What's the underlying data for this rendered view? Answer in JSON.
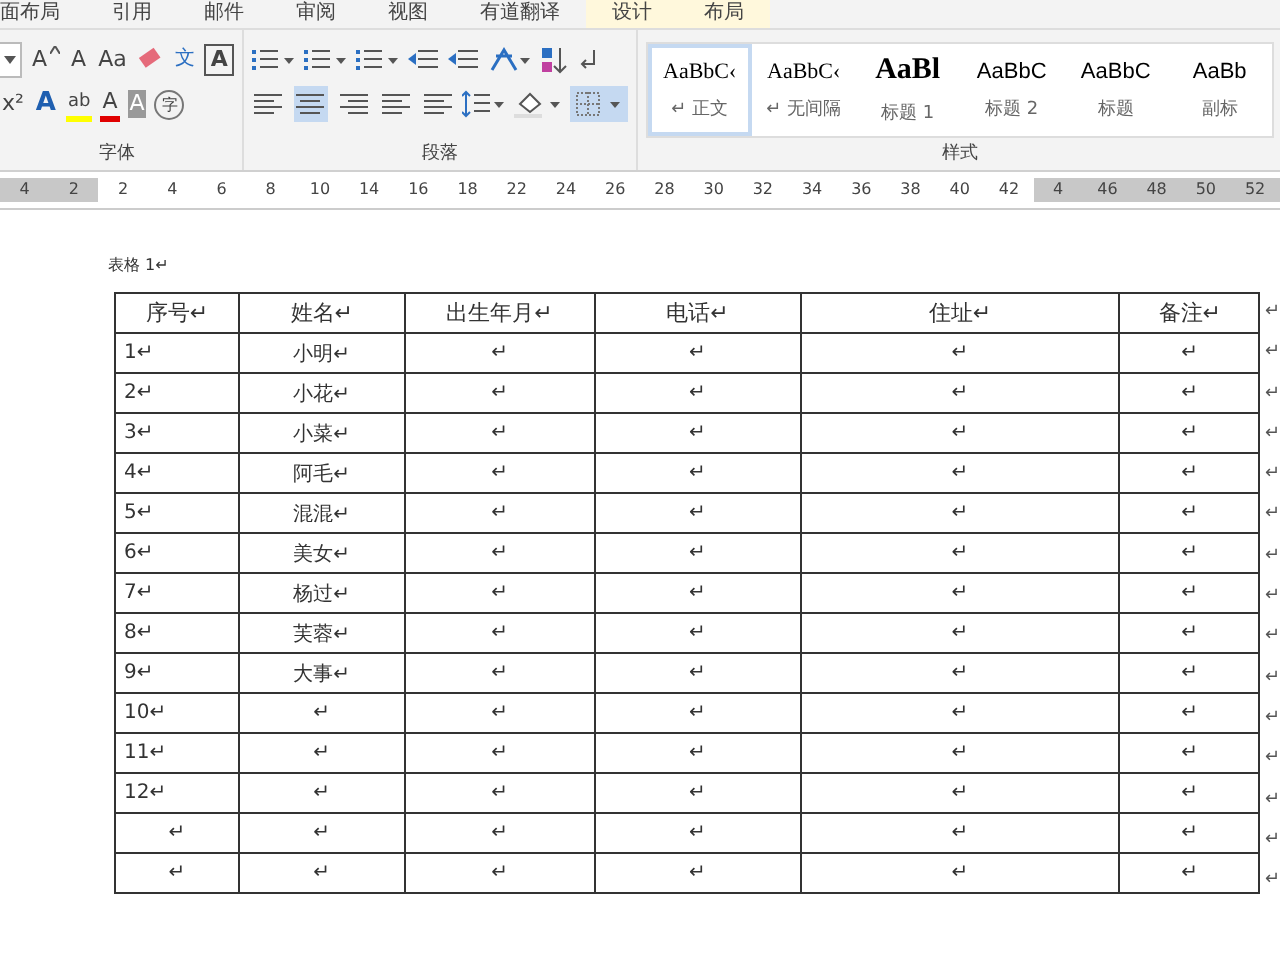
{
  "tabs": [
    {
      "label": "面布局",
      "contextual": false
    },
    {
      "label": "引用",
      "contextual": false
    },
    {
      "label": "邮件",
      "contextual": false
    },
    {
      "label": "审阅",
      "contextual": false
    },
    {
      "label": "视图",
      "contextual": false
    },
    {
      "label": "有道翻译",
      "contextual": false
    },
    {
      "label": "设计",
      "contextual": true
    },
    {
      "label": "布局",
      "contextual": true
    }
  ],
  "font_group": {
    "label": "字体",
    "grow": "A",
    "shrink": "A",
    "change_case": "Aa",
    "phonetic": "文",
    "border_char": "A",
    "superscript": "x²",
    "text_effect": "A",
    "highlight": "ab",
    "font_color": "A",
    "shading": "A",
    "enclose": "字"
  },
  "paragraph_group": {
    "label": "段落",
    "align_buttons": [
      {
        "selected": false
      },
      {
        "selected": true
      },
      {
        "selected": false
      },
      {
        "selected": false
      },
      {
        "selected": false
      }
    ],
    "borders_selected": true
  },
  "styles_group": {
    "label": "样式",
    "styles": [
      {
        "preview": "AaBbC‹",
        "name": "↵ 正文",
        "kind": "normal",
        "selected": true
      },
      {
        "preview": "AaBbC‹",
        "name": "↵ 无间隔",
        "kind": "normal",
        "selected": false
      },
      {
        "preview": "AaBl",
        "name": "标题 1",
        "kind": "heading",
        "selected": false
      },
      {
        "preview": "AaBbC",
        "name": "标题 2",
        "kind": "sans",
        "selected": false
      },
      {
        "preview": "AaBbC",
        "name": "标题",
        "kind": "sans",
        "selected": false
      },
      {
        "preview": "AaBb",
        "name": "副标",
        "kind": "sans",
        "selected": false
      }
    ]
  },
  "ruler": [
    "4",
    "2",
    "2",
    "4",
    "6",
    "8",
    "10",
    "14",
    "16",
    "18",
    "22",
    "24",
    "26",
    "28",
    "30",
    "32",
    "34",
    "36",
    "38",
    "40",
    "42",
    "4",
    "46",
    "48",
    "50",
    "52"
  ],
  "caption": "表格 1↵",
  "table": {
    "columns": [
      "序号↵",
      "姓名↵",
      "出生年月↵",
      "电话↵",
      "住址↵",
      "备注↵"
    ],
    "rows": [
      {
        "cells": [
          "1↵",
          "小明↵",
          "↵",
          "↵",
          "↵",
          "↵"
        ],
        "end": "↵"
      },
      {
        "cells": [
          "2↵",
          "小花↵",
          "↵",
          "↵",
          "↵",
          "↵"
        ],
        "end": "↵"
      },
      {
        "cells": [
          "3↵",
          "小菜↵",
          "↵",
          "↵",
          "↵",
          "↵"
        ],
        "end": "↵"
      },
      {
        "cells": [
          "4↵",
          "阿毛↵",
          "↵",
          "↵",
          "↵",
          "↵"
        ],
        "end": "↵"
      },
      {
        "cells": [
          "5↵",
          "混混↵",
          "↵",
          "↵",
          "↵",
          "↵"
        ],
        "end": "↵"
      },
      {
        "cells": [
          "6↵",
          "美女↵",
          "↵",
          "↵",
          "↵",
          "↵"
        ],
        "end": "↵"
      },
      {
        "cells": [
          "7↵",
          "杨过↵",
          "↵",
          "↵",
          "↵",
          "↵"
        ],
        "end": "↵"
      },
      {
        "cells": [
          "8↵",
          "芙蓉↵",
          "↵",
          "↵",
          "↵",
          "↵"
        ],
        "end": "↵"
      },
      {
        "cells": [
          "9↵",
          "大事↵",
          "↵",
          "↵",
          "↵",
          "↵"
        ],
        "end": "↵"
      },
      {
        "cells": [
          "10↵",
          "↵",
          "↵",
          "↵",
          "↵",
          "↵"
        ],
        "end": "↵"
      },
      {
        "cells": [
          "11↵",
          "↵",
          "↵",
          "↵",
          "↵",
          "↵"
        ],
        "end": "↵"
      },
      {
        "cells": [
          "12↵",
          "↵",
          "↵",
          "↵",
          "↵",
          "↵"
        ],
        "end": "↵"
      },
      {
        "cells": [
          "↵",
          "↵",
          "↵",
          "↵",
          "↵",
          "↵"
        ],
        "end": "↵"
      },
      {
        "cells": [
          "↵",
          "↵",
          "↵",
          "↵",
          "↵",
          "↵"
        ],
        "end": "↵"
      }
    ]
  },
  "header_end": "↵"
}
